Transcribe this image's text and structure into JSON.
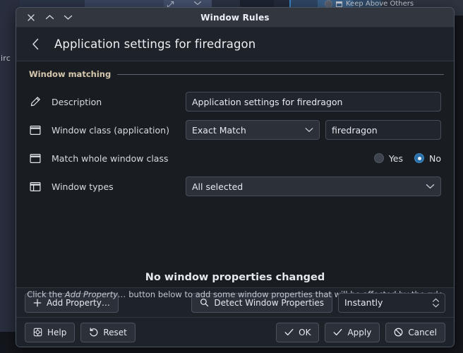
{
  "desktop": {
    "left_label": "irc",
    "keep_above_label": "Keep Above Others",
    "expand_icon": "expand-icon",
    "caret_icon": "chevron-down-icon"
  },
  "window": {
    "title": "Window Rules",
    "controls": {
      "close": "✕",
      "shade_up": "⌃",
      "shade_down": "⌄"
    }
  },
  "header": {
    "back_icon": "‹",
    "title": "Application settings for firedragon"
  },
  "group": {
    "title": "Window matching"
  },
  "form": {
    "rows": [
      {
        "icon": "pencil-icon",
        "label": "Description",
        "value": "Application settings for firedragon"
      },
      {
        "icon": "window-icon",
        "label": "Window class (application)",
        "match_mode": "Exact Match",
        "value": "firedragon"
      },
      {
        "icon": "window-icon",
        "label": "Match whole window class",
        "options": [
          "Yes",
          "No"
        ],
        "selected": "No"
      },
      {
        "icon": "window-types-icon",
        "label": "Window types",
        "value": "All selected"
      }
    ]
  },
  "empty_state": {
    "title": "No window properties changed",
    "subtitle_before": "Click the ",
    "subtitle_emphasis": "Add Property…",
    "subtitle_after": " button below to add some window properties that will be affected by the rule"
  },
  "actions": {
    "add_property": "Add Property…",
    "detect": "Detect Window Properties",
    "detect_when": "Instantly"
  },
  "footer": {
    "help": "Help",
    "reset": "Reset",
    "ok": "OK",
    "apply": "Apply",
    "cancel": "Cancel"
  },
  "colors": {
    "accent": "#2b6fa8",
    "accent_border": "#3d8ac4",
    "group_title": "#d6c8ae",
    "dialog_bg": "#191c21",
    "titlebar_bg": "#31363f"
  }
}
